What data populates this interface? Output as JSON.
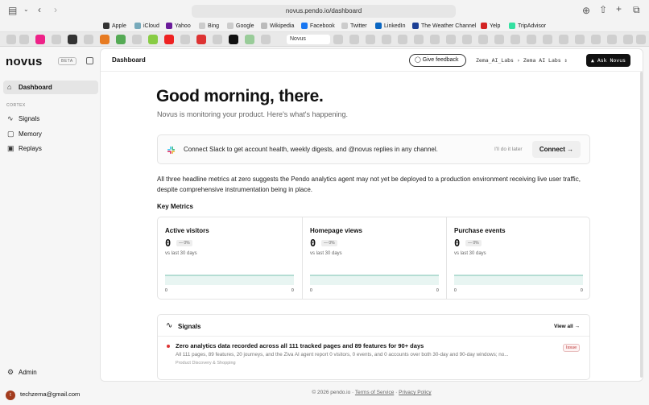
{
  "browser": {
    "url": "novus.pendo.io/dashboard",
    "bookmarks": [
      {
        "label": "Apple",
        "icon": "apple-icon"
      },
      {
        "label": "iCloud",
        "icon": "icloud-icon"
      },
      {
        "label": "Yahoo",
        "icon": "yahoo-icon"
      },
      {
        "label": "Bing",
        "icon": "bing-icon"
      },
      {
        "label": "Google",
        "icon": "google-icon"
      },
      {
        "label": "Wikipedia",
        "icon": "wikipedia-icon"
      },
      {
        "label": "Facebook",
        "icon": "facebook-icon"
      },
      {
        "label": "Twitter",
        "icon": "twitter-icon"
      },
      {
        "label": "LinkedIn",
        "icon": "linkedin-icon"
      },
      {
        "label": "The Weather Channel",
        "icon": "weather-icon"
      },
      {
        "label": "Yelp",
        "icon": "yelp-icon"
      },
      {
        "label": "TripAdvisor",
        "icon": "tripadvisor-icon"
      }
    ],
    "active_tab": "Novus"
  },
  "sidebar": {
    "logo": "novus",
    "badge": "BETA",
    "dashboard": "Dashboard",
    "section": "CORTEX",
    "items": [
      "Signals",
      "Memory",
      "Replays"
    ],
    "admin": "Admin",
    "user_email": "techzema@gmail.com",
    "user_initial": "t"
  },
  "header": {
    "breadcrumb": "Dashboard",
    "feedback": "Give feedback",
    "org": "Zema_AI_Labs",
    "project": "Zema AI Labs",
    "ask": "Ask Novus"
  },
  "main": {
    "greeting": "Good morning, there.",
    "subtitle": "Novus is monitoring your product. Here's what's happening.",
    "slack": {
      "text": "Connect Slack to get account health, weekly digests, and @novus replies in any channel.",
      "later": "I'll do it later",
      "connect": "Connect →"
    },
    "insight": "All three headline metrics at zero suggests the Pendo analytics agent may not yet be deployed to a production environment receiving live user traffic, despite comprehensive instrumentation being in place.",
    "key_metrics_title": "Key Metrics",
    "metrics": [
      {
        "title": "Active visitors",
        "value": "0",
        "delta": "— 0%",
        "vs": "vs last 30 days",
        "start": "0",
        "end": "0"
      },
      {
        "title": "Homepage views",
        "value": "0",
        "delta": "— 0%",
        "vs": "vs last 30 days",
        "start": "0",
        "end": "0"
      },
      {
        "title": "Purchase events",
        "value": "0",
        "delta": "— 0%",
        "vs": "vs last 30 days",
        "start": "0",
        "end": "0"
      }
    ],
    "signals": {
      "title": "Signals",
      "view_all": "View all →",
      "item": {
        "title": "Zero analytics data recorded across all 111 tracked pages and 89 features for 90+ days",
        "desc": "All 111 pages, 89 features, 20 journeys, and the Ziva AI agent report 0 visitors, 0 events, and 0 accounts over both 30-day and 90-day windows; no...",
        "category": "Product Discovery & Shopping",
        "badge": "Issue"
      }
    }
  },
  "footer": {
    "copyright": "© 2026 pendo.io ·",
    "terms": "Terms of Service",
    "sep": "·",
    "privacy": "Privacy Policy"
  },
  "colors": {
    "accent": "#111111",
    "spark": "#bfe3dc",
    "issue": "#d33333"
  }
}
